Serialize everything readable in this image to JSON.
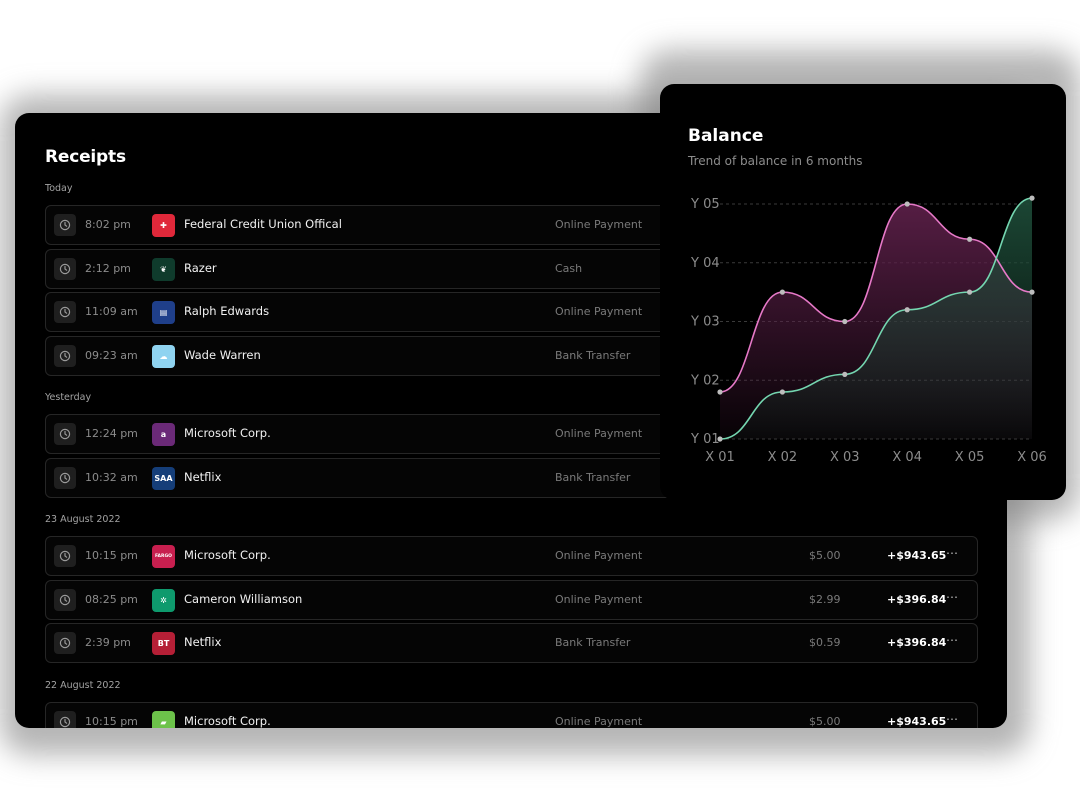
{
  "receipts": {
    "title": "Receipts",
    "groups": [
      {
        "label": "Today",
        "rows": [
          {
            "time": "8:02 pm",
            "name": "Federal Credit Union Offical",
            "method": "Online Payment",
            "logo_color": "#e0283a",
            "logo_text": "✚"
          },
          {
            "time": "2:12 pm",
            "name": "Razer",
            "method": "Cash",
            "logo_color": "#0f3b2c",
            "logo_text": "❦"
          },
          {
            "time": "11:09 am",
            "name": "Ralph Edwards",
            "method": "Online Payment",
            "logo_color": "#1f3f8a",
            "logo_text": "▤"
          },
          {
            "time": "09:23 am",
            "name": "Wade Warren",
            "method": "Bank Transfer",
            "logo_color": "#8fd3f0",
            "logo_text": "☁"
          }
        ]
      },
      {
        "label": "Yesterday",
        "rows": [
          {
            "time": "12:24 pm",
            "name": "Microsoft Corp.",
            "method": "Online Payment",
            "logo_color": "#6b2a78",
            "logo_text": "a"
          },
          {
            "time": "10:32 am",
            "name": "Netflix",
            "method": "Bank Transfer",
            "logo_color": "#153e79",
            "logo_text": "SAA"
          }
        ]
      },
      {
        "label": "23 August 2022",
        "rows": [
          {
            "time": "10:15 pm",
            "name": "Microsoft Corp.",
            "method": "Online Payment",
            "fee": "$5.00",
            "amount": "+$943.65",
            "logo_color": "#c81f4f",
            "logo_text": "FARGO"
          },
          {
            "time": "08:25 pm",
            "name": "Cameron Williamson",
            "method": "Online Payment",
            "fee": "$2.99",
            "amount": "+$396.84",
            "logo_color": "#0e9a6d",
            "logo_text": "✲"
          },
          {
            "time": "2:39 pm",
            "name": "Netflix",
            "method": "Bank Transfer",
            "fee": "$0.59",
            "amount": "+$396.84",
            "logo_color": "#b51f36",
            "logo_text": "BT"
          }
        ]
      },
      {
        "label": "22 August 2022",
        "rows": [
          {
            "time": "10:15 pm",
            "name": "Microsoft Corp.",
            "method": "Online Payment",
            "fee": "$5.00",
            "amount": "+$943.65",
            "logo_color": "#6cc24a",
            "logo_text": "▰"
          }
        ]
      }
    ]
  },
  "balance": {
    "title": "Balance",
    "subtitle": "Trend of balance in 6 months"
  },
  "chart_data": {
    "type": "area",
    "categories": [
      "X 01",
      "X 02",
      "X 03",
      "X 04",
      "X 05",
      "X 06"
    ],
    "y_ticks": [
      "Y 01",
      "Y 02",
      "Y 03",
      "Y 04",
      "Y 05"
    ],
    "ylim": [
      1,
      5
    ],
    "grid": true,
    "series": [
      {
        "color": "#e779c8",
        "fill": "#5a1f47",
        "values": [
          1.8,
          3.5,
          3.0,
          5.0,
          4.4,
          3.5
        ]
      },
      {
        "color": "#74d6b0",
        "fill": "#1d4a37",
        "values": [
          1.0,
          1.8,
          2.1,
          3.2,
          3.5,
          5.1
        ]
      }
    ]
  }
}
